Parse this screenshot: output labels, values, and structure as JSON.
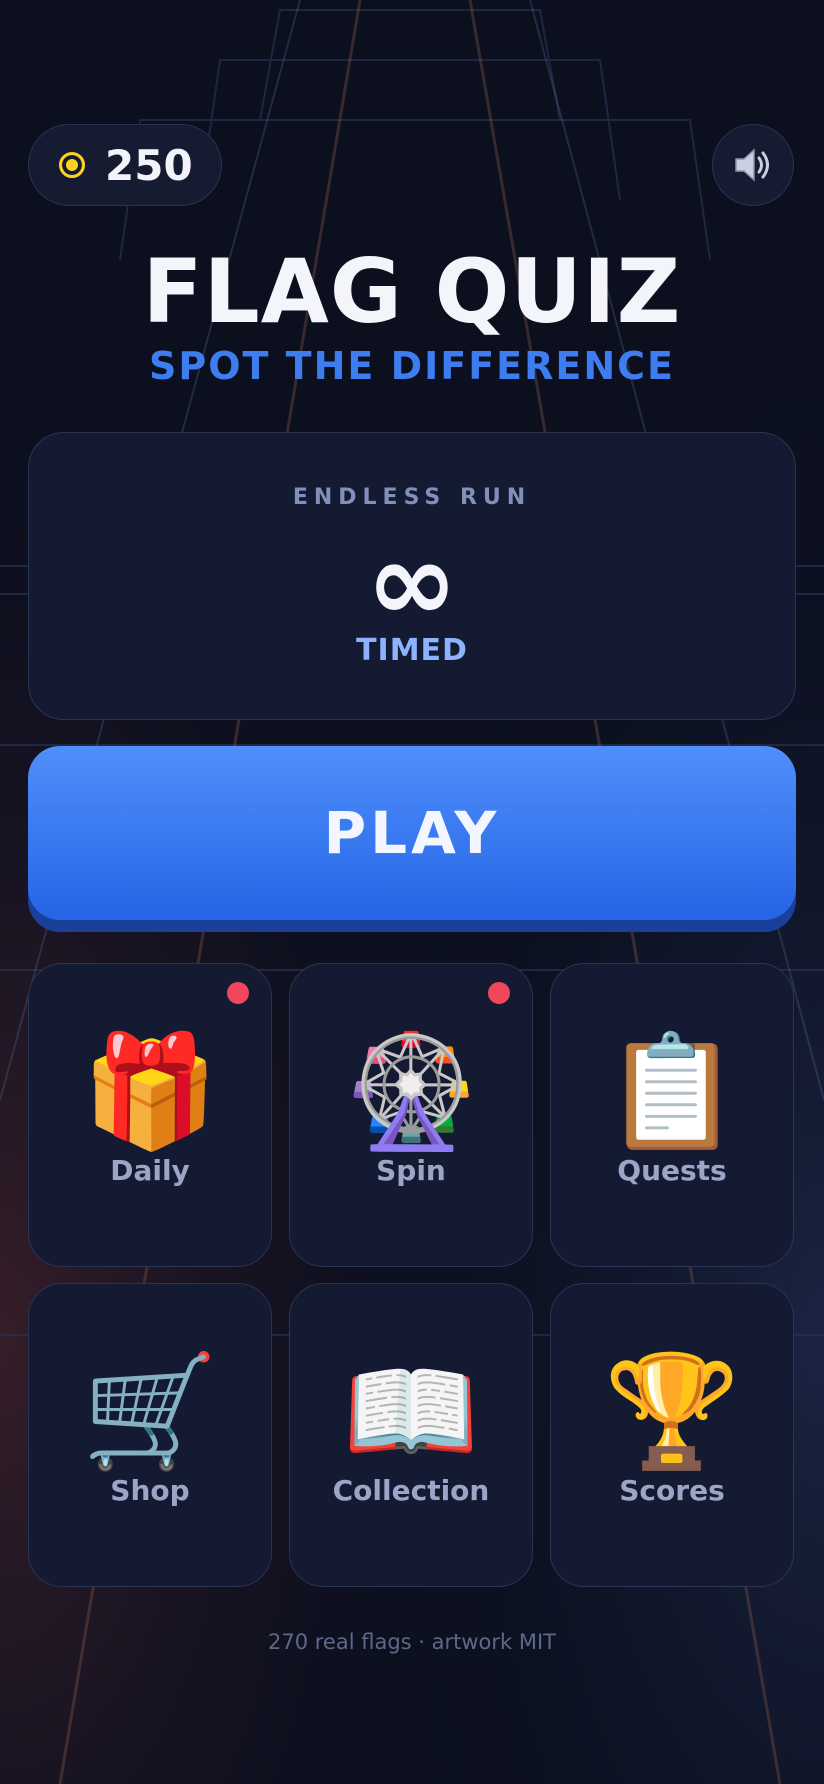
{
  "hud": {
    "coins": "250",
    "coin_icon": "coin-icon",
    "sound_icon": "speaker-icon"
  },
  "title": "FLAG QUIZ",
  "subtitle": "SPOT THE DIFFERENCE",
  "mode_card": {
    "label": "ENDLESS RUN",
    "symbol": "∞",
    "sub": "TIMED"
  },
  "play_button": "PLAY",
  "menu": [
    {
      "label": "Daily",
      "icon": "🎁",
      "icon_name": "gift-icon",
      "badge": true
    },
    {
      "label": "Spin",
      "icon": "🎡",
      "icon_name": "ferris-wheel-icon",
      "badge": true
    },
    {
      "label": "Quests",
      "icon": "📋",
      "icon_name": "clipboard-icon",
      "badge": false
    },
    {
      "label": "Shop",
      "icon": "🛒",
      "icon_name": "cart-icon",
      "badge": false
    },
    {
      "label": "Collection",
      "icon": "📖",
      "icon_name": "book-icon",
      "badge": false
    },
    {
      "label": "Scores",
      "icon": "🏆",
      "icon_name": "trophy-icon",
      "badge": false
    }
  ],
  "footer": "270 real flags · artwork MIT",
  "colors": {
    "background": "#0b0f1e",
    "accent": "#3d7df0",
    "play_top": "#4f8ffb",
    "play_bottom": "#2565e6",
    "badge": "#f0485a",
    "coin": "#ffd21f"
  }
}
